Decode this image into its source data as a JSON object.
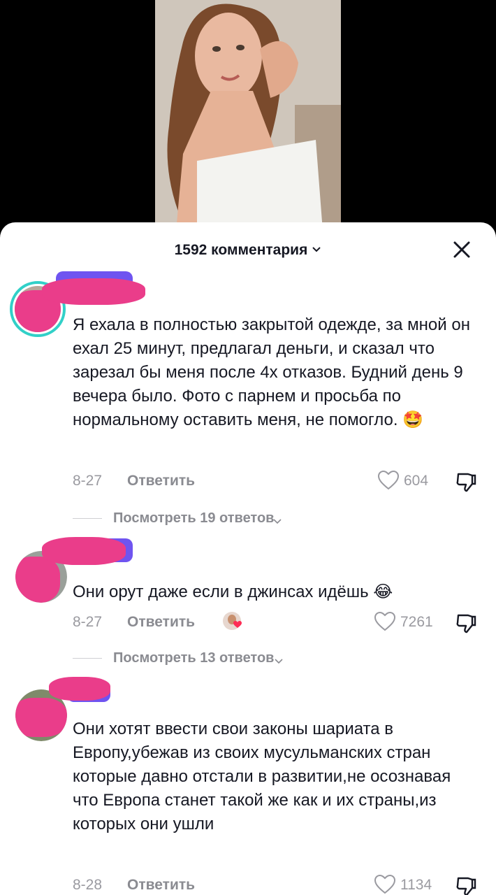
{
  "header": {
    "comment_count_label": "1592 комментария"
  },
  "comments": [
    {
      "text": "Я ехала в полностью закрытой одежде, за мной он ехал 25 минут, предлагал деньги, и сказал что зарезал бы меня после 4х отказов. Будний день 9 вечера было. Фото с парнем и просьба по нормальному оставить меня, не помогло. 🤩",
      "date": "8-27",
      "reply_label": "Ответить",
      "likes": "604",
      "view_replies": "Посмотреть 19 ответов"
    },
    {
      "text": "Они орут даже если в джинсах идёшь 😂",
      "date": "8-27",
      "reply_label": "Ответить",
      "likes": "7261",
      "view_replies": "Посмотреть 13 ответов"
    },
    {
      "text": "Они хотят ввести свои законы шариата в Европу,убежав из своих мусульманских стран которые давно отстали в развитии,не осознавая что Европа станет такой же как и их страны,из которых они ушли",
      "date": "8-28",
      "reply_label": "Ответить",
      "likes": "1134"
    }
  ],
  "icons": {
    "close": "close-icon",
    "chevron": "chevron-down-icon",
    "like": "heart-icon",
    "dislike": "thumbs-down-icon"
  },
  "colors": {
    "avatar_ring": "#31d0c8",
    "redaction_pink": "#ea3d8a",
    "redaction_purple": "#6f54f0"
  }
}
